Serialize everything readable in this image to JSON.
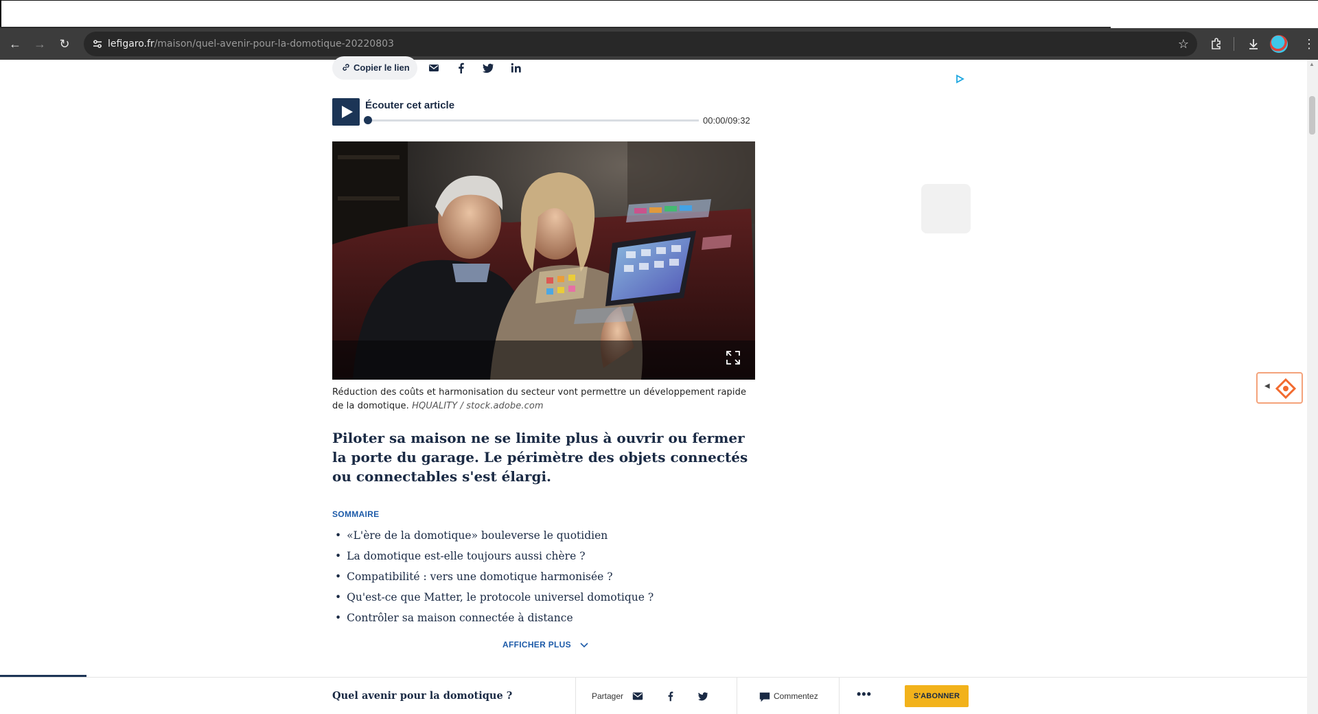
{
  "browser": {
    "url_host": "lefigaro.fr",
    "url_path": "/maison/quel-avenir-pour-la-domotique-20220803"
  },
  "share": {
    "copy_link_label": "Copier le lien",
    "icons": [
      "mail-icon",
      "facebook-icon",
      "twitter-icon",
      "linkedin-icon"
    ]
  },
  "audio": {
    "label": "Écouter cet article",
    "time": "00:00/09:32",
    "progress": 0
  },
  "image": {
    "caption": "Réduction des coûts et harmonisation du secteur vont permettre un développement rapide de la domotique.",
    "credit": "HQUALITY / stock.adobe.com"
  },
  "chapo": "Piloter sa maison ne se limite plus à ouvrir ou fermer la porte du garage. Le périmètre des objets connectés ou connectables s'est élargi.",
  "sommaire": {
    "title": "SOMMAIRE",
    "items": [
      "«L'ère de la domotique» bouleverse le quotidien",
      "La domotique est-elle toujours aussi chère ?",
      "Compatibilité : vers une domotique harmonisée ?",
      "Qu'est-ce que Matter, le protocole universel domotique ?",
      "Contrôler sa maison connectée à distance"
    ],
    "more_label": "AFFICHER PLUS"
  },
  "bottom_bar": {
    "title": "Quel avenir pour la domotique ?",
    "share_label": "Partager",
    "comment_label": "Commentez",
    "more_label": "•••",
    "subscribe_label": "S'ABONNER",
    "read_progress": 0.066
  },
  "colors": {
    "navy": "#1a2a44",
    "accent_blue": "#1c5aa8",
    "subscribe_yellow": "#f2b21b",
    "widget_orange": "#f26a2e"
  }
}
